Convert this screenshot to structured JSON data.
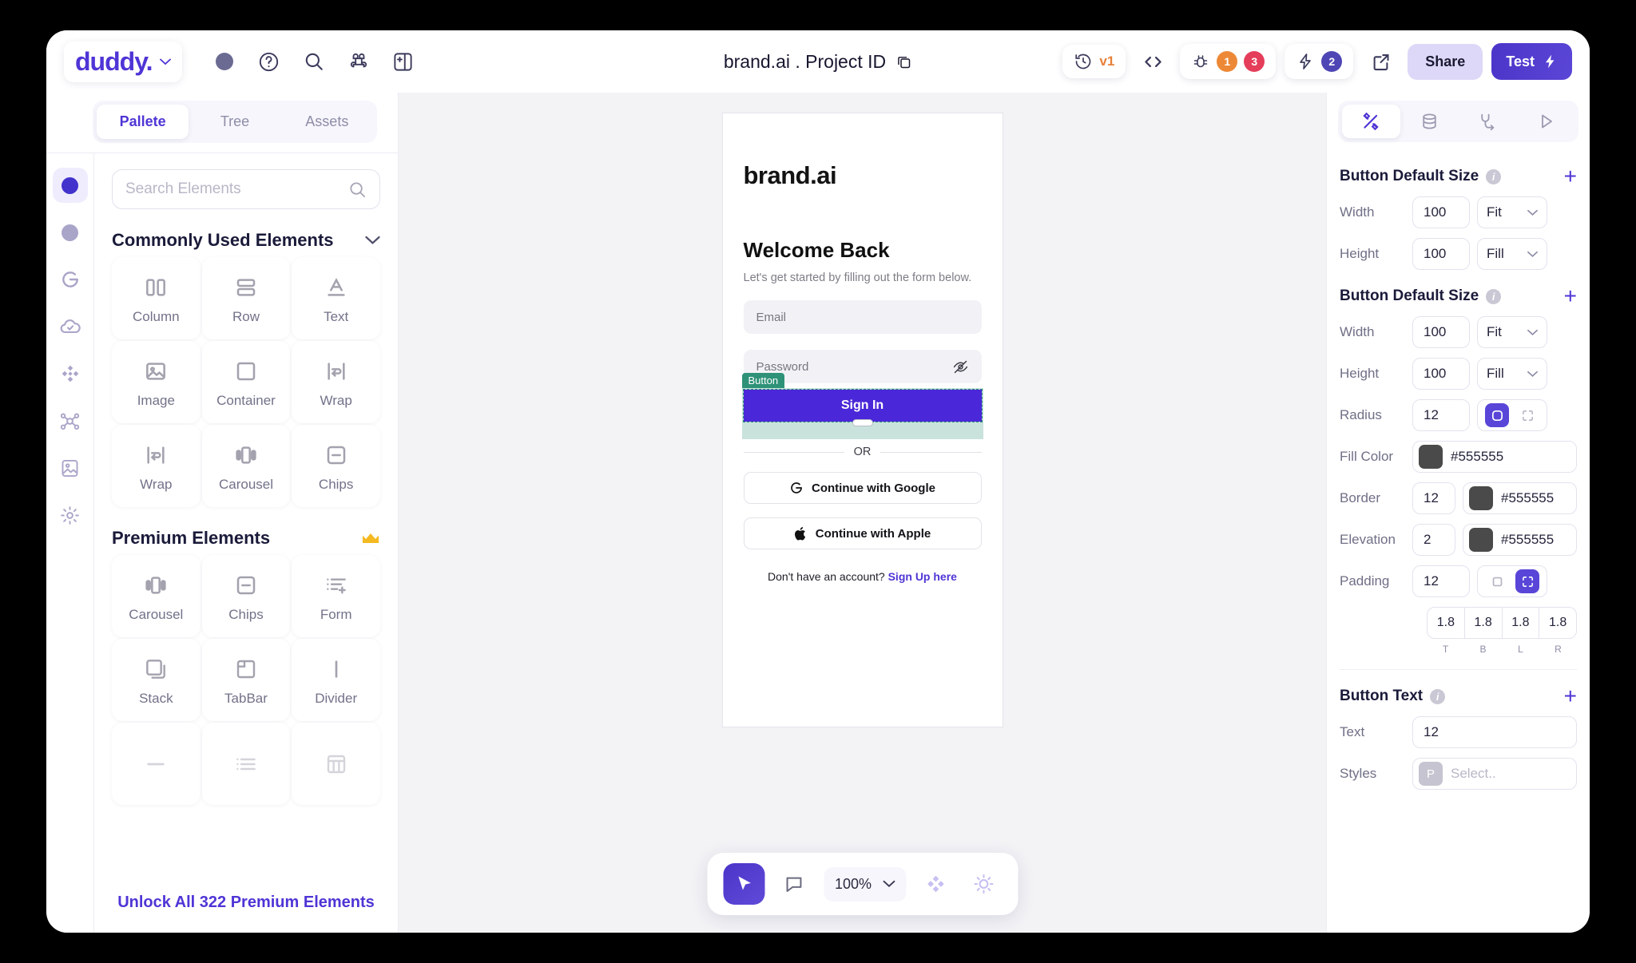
{
  "topbar": {
    "logo": "duddy.",
    "logo_caret": "chevron-down",
    "project_title": "brand.ai . Project ID",
    "version_label": "v1",
    "bug_count_warn": "1",
    "bug_count_err": "3",
    "bolt_count": "2",
    "share_label": "Share",
    "test_label": "Test",
    "accent": "#4f35d6"
  },
  "left": {
    "tabs": [
      {
        "label": "Pallete",
        "active": true
      },
      {
        "label": "Tree",
        "active": false
      },
      {
        "label": "Assets",
        "active": false
      }
    ],
    "search_placeholder": "Search Elements",
    "search_value": "",
    "sections": [
      {
        "title": "Commonly Used Elements",
        "premium": false,
        "items": [
          {
            "label": "Column",
            "icon": "column-icon"
          },
          {
            "label": "Row",
            "icon": "row-icon"
          },
          {
            "label": "Text",
            "icon": "text-icon"
          },
          {
            "label": "Image",
            "icon": "image-icon"
          },
          {
            "label": "Container",
            "icon": "container-icon"
          },
          {
            "label": "Wrap",
            "icon": "wrap-icon"
          },
          {
            "label": "Wrap",
            "icon": "wrap-icon"
          },
          {
            "label": "Carousel",
            "icon": "carousel-icon"
          },
          {
            "label": "Chips",
            "icon": "chips-icon"
          }
        ]
      },
      {
        "title": "Premium Elements",
        "premium": true,
        "items": [
          {
            "label": "Carousel",
            "icon": "carousel-icon"
          },
          {
            "label": "Chips",
            "icon": "chips-icon"
          },
          {
            "label": "Form",
            "icon": "form-icon"
          },
          {
            "label": "Stack",
            "icon": "stack-icon"
          },
          {
            "label": "TabBar",
            "icon": "tabbar-icon"
          },
          {
            "label": "Divider",
            "icon": "divider-icon"
          }
        ]
      }
    ],
    "unlock_label": "Unlock All 322 Premium Elements",
    "rail_icons": [
      "circle-filled-icon",
      "circle-muted-icon",
      "google-icon",
      "cloud-check-icon",
      "diamond-grid-icon",
      "node-graph-icon",
      "media-icon",
      "gear-icon"
    ]
  },
  "canvas": {
    "brand": "brand.ai",
    "heading": "Welcome Back",
    "subtitle": "Let's get started by filling out the form below.",
    "email_placeholder": "Email",
    "password_placeholder": "Password",
    "selection_tag": "Button",
    "signin_label": "Sign In",
    "or_label": "OR",
    "google_label": "Continue with Google",
    "apple_label": "Continue with Apple",
    "signup_prefix": "Don't have an account?",
    "signup_link": "Sign Up here"
  },
  "floatbar": {
    "zoom_value": "100%",
    "tools": [
      "cursor-icon",
      "comment-icon",
      "zoom-select",
      "components-icon",
      "theme-icon"
    ]
  },
  "right": {
    "tabs": [
      "design-icon",
      "database-icon",
      "inspect-icon",
      "run-icon"
    ],
    "groups": [
      {
        "title": "Button Default Size",
        "add_label": "+",
        "rows": [
          {
            "label": "Width",
            "value": "100",
            "mode": "Fit"
          },
          {
            "label": "Height",
            "value": "100",
            "mode": "Fill"
          }
        ]
      },
      {
        "title": "Button Default Size",
        "add_label": "+",
        "rows": [
          {
            "label": "Width",
            "value": "100",
            "mode": "Fit"
          },
          {
            "label": "Height",
            "value": "100",
            "mode": "Fill"
          }
        ],
        "radius": {
          "label": "Radius",
          "value": "12"
        },
        "fill_color": {
          "label": "Fill Color",
          "hex": "#555555",
          "swatch": "#4a4a4a"
        },
        "border": {
          "label": "Border",
          "value": "12",
          "hex": "#555555",
          "swatch": "#4a4a4a"
        },
        "elevation": {
          "label": "Elevation",
          "value": "2",
          "hex": "#555555",
          "swatch": "#4a4a4a"
        },
        "padding": {
          "label": "Padding",
          "value": "12",
          "sides": [
            "1.8",
            "1.8",
            "1.8",
            "1.8"
          ],
          "side_labels": [
            "T",
            "B",
            "L",
            "R"
          ]
        }
      },
      {
        "title": "Button Text",
        "add_label": "+",
        "text_row": {
          "label": "Text",
          "value": "12"
        },
        "styles_row": {
          "label": "Styles",
          "badge": "P",
          "placeholder": "Select.."
        }
      }
    ]
  }
}
